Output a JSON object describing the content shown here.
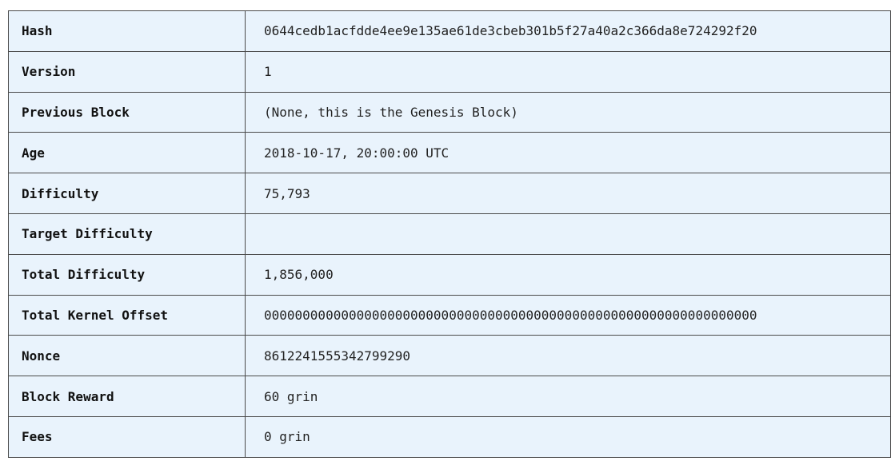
{
  "rows": [
    {
      "label": "Hash",
      "value": "0644cedb1acfdde4ee9e135ae61de3cbeb301b5f27a40a2c366da8e724292f20"
    },
    {
      "label": "Version",
      "value": "1"
    },
    {
      "label": "Previous Block",
      "value": "(None, this is the Genesis Block)"
    },
    {
      "label": "Age",
      "value": "2018-10-17, 20:00:00 UTC"
    },
    {
      "label": "Difficulty",
      "value": "75,793"
    },
    {
      "label": "Target Difficulty",
      "value": ""
    },
    {
      "label": "Total Difficulty",
      "value": "1,856,000"
    },
    {
      "label": "Total Kernel Offset",
      "value": "0000000000000000000000000000000000000000000000000000000000000000"
    },
    {
      "label": "Nonce",
      "value": "8612241555342799290"
    },
    {
      "label": "Block Reward",
      "value": "60 grin"
    },
    {
      "label": "Fees",
      "value": "0 grin"
    }
  ]
}
